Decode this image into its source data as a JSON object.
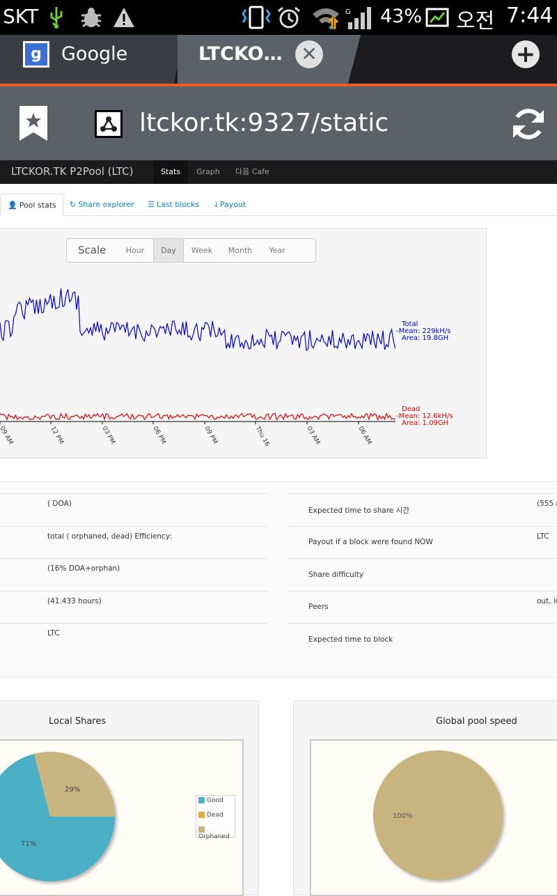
{
  "status_bar": {
    "carrier": "SKT",
    "battery": "43%",
    "ampm": "오전",
    "time": "7:44"
  },
  "tabs": [
    {
      "label": "Google",
      "favicon": "google-g-icon"
    },
    {
      "label": "LTCKO…",
      "favicon": "p2pool-icon"
    }
  ],
  "url_bar": {
    "url": "ltckor.tk:9327/static"
  },
  "site": {
    "brand": "LTCKOR.TK P2Pool (LTC)",
    "nav": [
      "Stats",
      "Graph",
      "다음 Cafe"
    ],
    "nav_active": "Stats"
  },
  "subtabs": [
    "Pool stats",
    "Share explorer",
    "Last blocks",
    "Payout"
  ],
  "scale": {
    "label": "Scale",
    "options": [
      "Hour",
      "Day",
      "Week",
      "Month",
      "Year"
    ],
    "active": "Day"
  },
  "chart_data": {
    "type": "line",
    "x_ticks": [
      "09 AM",
      "12 PM",
      "03 PM",
      "06 PM",
      "09 PM",
      "Thu 16",
      "03 AM",
      "06 AM"
    ],
    "series": [
      {
        "name": "Total",
        "mean": "Mean: 229kH/s",
        "area": "Area: 19.8GH",
        "color": "#0000cc"
      },
      {
        "name": "Dead",
        "mean": "Mean: 12.6kH/s",
        "area": "Area: 1.09GH",
        "color": "#dd0000"
      }
    ]
  },
  "stats_table": {
    "left": [
      "( DOA)",
      "total ( orphaned, dead) Efficiency:",
      "(16% DOA+orphan)",
      "(41.433 hours)",
      "LTC"
    ],
    "right_labels": [
      "Expected time to share 시간",
      "Payout if a block were found NOW",
      "Share difficulty",
      "Peers",
      "Expected time to block"
    ],
    "right_values": [
      "(555 r",
      "LTC",
      "",
      "out, in",
      ""
    ]
  },
  "local_shares": {
    "title": "Local Shares",
    "slices": [
      {
        "label": "Good",
        "percent": 71,
        "color": "#4bafc6"
      },
      {
        "label": "Dead",
        "percent": 0,
        "color": "#eba73b"
      },
      {
        "label": "Orphaned",
        "percent": 29,
        "color": "#c8b47f"
      }
    ],
    "labels": [
      "71%",
      "29%"
    ]
  },
  "global_pool": {
    "title": "Global pool speed",
    "label": "100%",
    "color": "#c8b47f"
  }
}
